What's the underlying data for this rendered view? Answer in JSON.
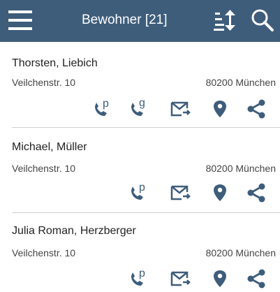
{
  "header": {
    "title": "Bewohner [21]",
    "icons": [
      "menu-icon",
      "sort-icon",
      "search-icon"
    ]
  },
  "residents": [
    {
      "name": "Thorsten, Liebich",
      "street": "Veilchenstr. 10",
      "city": "80200 München",
      "actions": [
        "phone-private",
        "phone-business",
        "message",
        "location",
        "share"
      ],
      "phone_private_letter": "p",
      "phone_business_letter": "g"
    },
    {
      "name": "Michael, Müller",
      "street": "Veilchenstr. 10",
      "city": "80200 München",
      "actions": [
        "phone-private",
        "message",
        "location",
        "share"
      ],
      "phone_private_letter": "p"
    },
    {
      "name": "Julia  Roman, Herzberger",
      "street": "Veilchenstr. 10",
      "city": "80200 München",
      "actions": [
        "phone-private",
        "message",
        "location",
        "share"
      ],
      "phone_private_letter": "p"
    }
  ],
  "colors": {
    "appbar": "#3e5d7b",
    "icon": "#3e5d7b",
    "divider": "#cfcfcf"
  }
}
